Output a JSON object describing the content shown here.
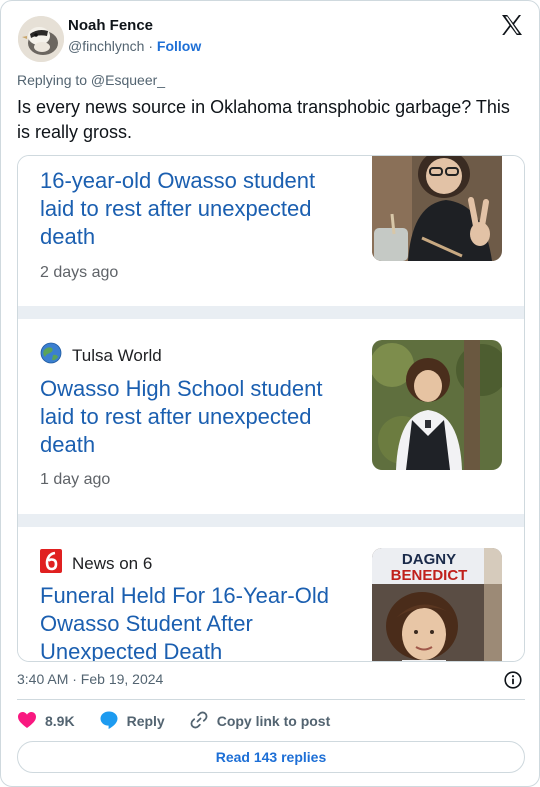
{
  "author": {
    "name": "Noah Fence",
    "handle": "@finchlynch",
    "separator": "·",
    "follow_label": "Follow"
  },
  "reply_context": "Replying to @Esqueer_",
  "tweet_text": "Is every news source in Oklahoma transphobic garbage? This is really gross.",
  "embedded": {
    "items": [
      {
        "source": "",
        "headline": "16-year-old Owasso student laid to rest after unexpected death",
        "age": "2 days ago",
        "thumb": "photo-person-peace-sign"
      },
      {
        "source": "Tulsa World",
        "source_icon": "globe-icon",
        "headline": "Owasso High School student laid to rest after unexpected death",
        "age": "1 day ago",
        "thumb": "photo-student-vest"
      },
      {
        "source": "News on 6",
        "source_icon": "news-on-6-logo",
        "headline": "Funeral Held For 16-Year-Old Owasso Student After Unexpected Death",
        "age": "",
        "thumb": "photo-dagny-benedict",
        "thumb_caption": [
          "DAGNY",
          "BENEDICT"
        ]
      }
    ]
  },
  "timestamp": "3:40 AM · Feb 19, 2024",
  "actions": {
    "likes": "8.9K",
    "reply_label": "Reply",
    "copy_label": "Copy link to post"
  },
  "read_replies": "Read 143 replies",
  "colors": {
    "link": "#1d6fd6",
    "headline": "#1b5fb0",
    "heart": "#f91880",
    "reply_bubble": "#1d9bf0",
    "muted": "#536471"
  }
}
